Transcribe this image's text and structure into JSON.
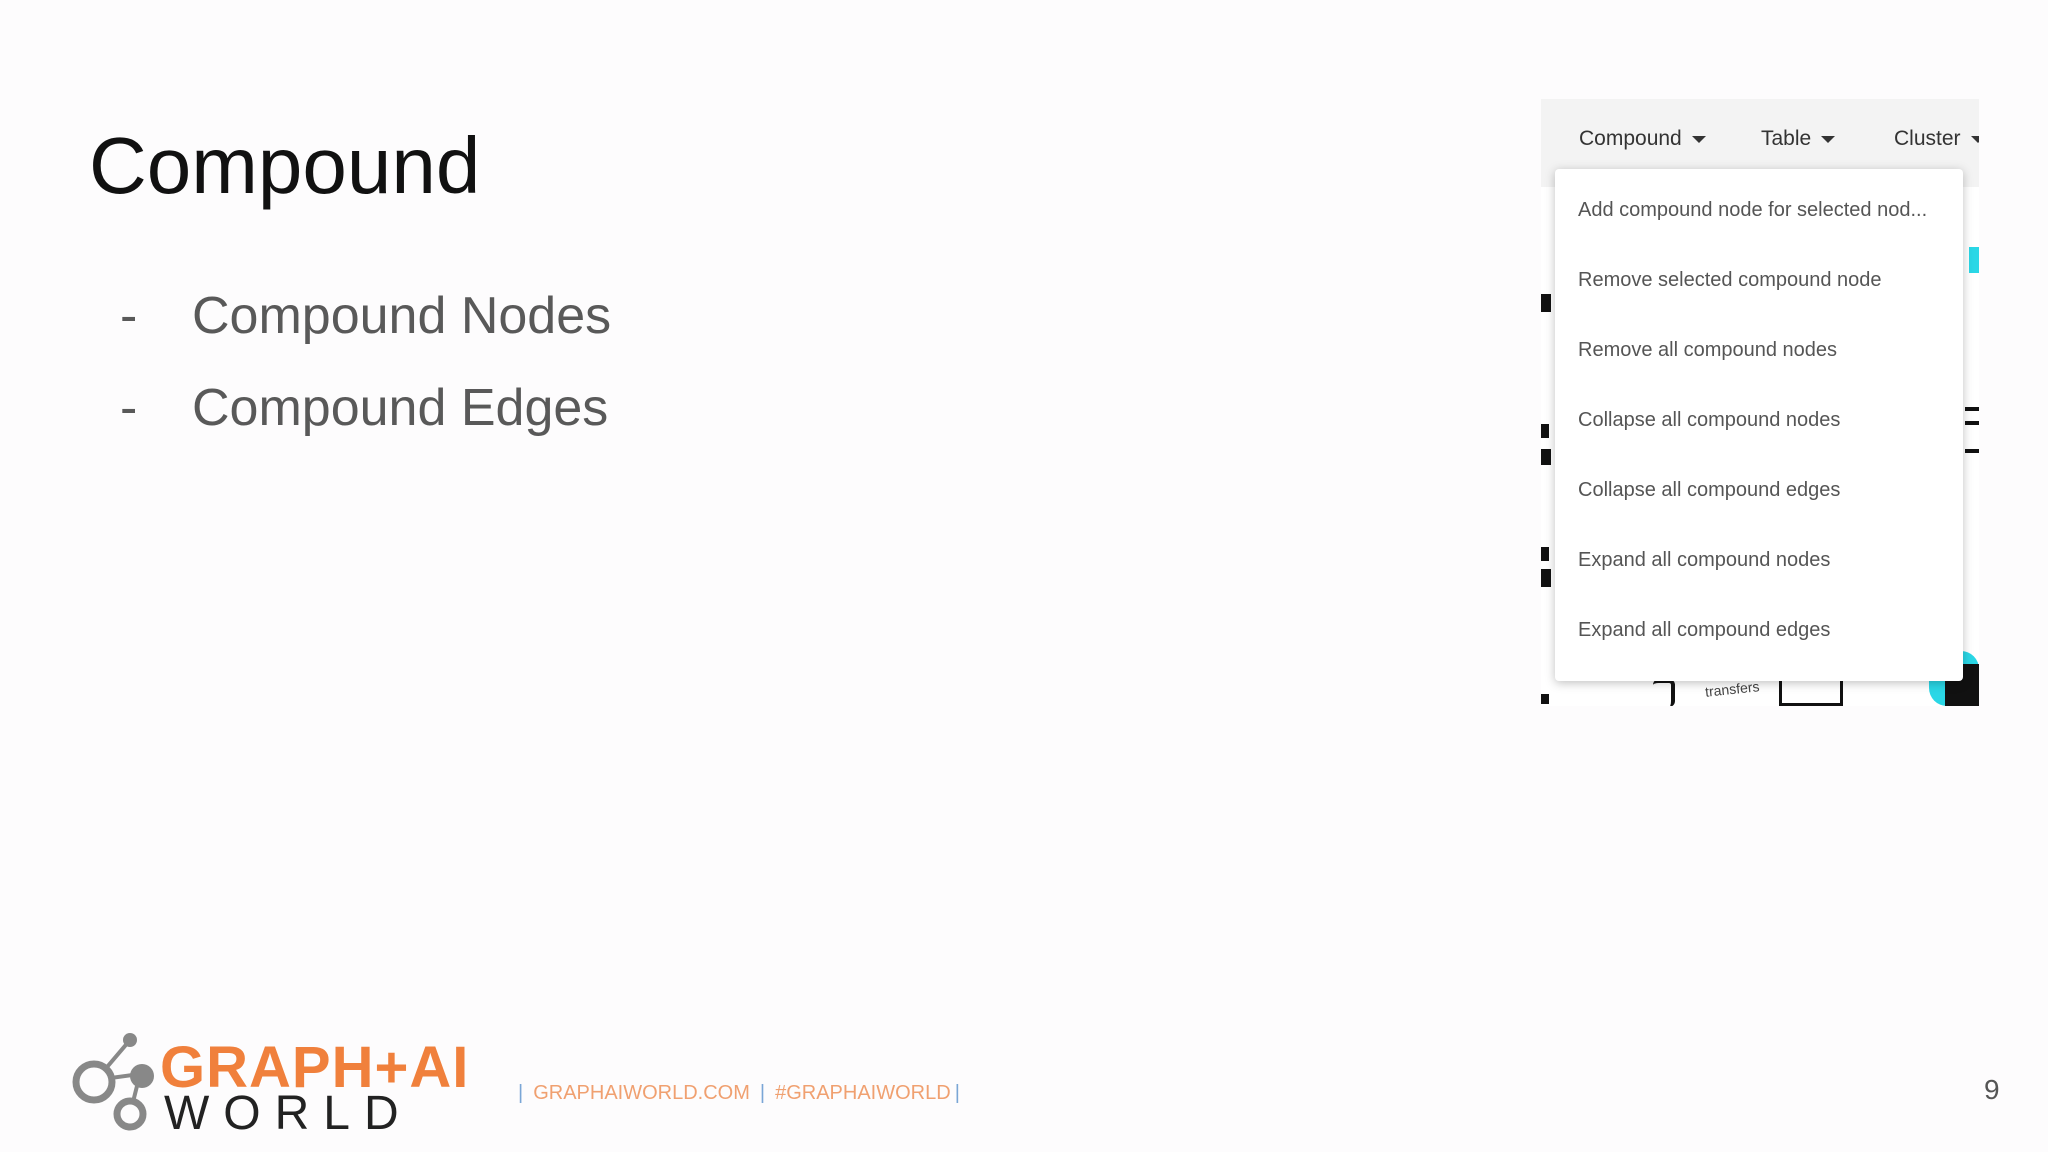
{
  "slide": {
    "title": "Compound",
    "bullets": [
      {
        "dash": "-",
        "text": "Compound Nodes"
      },
      {
        "dash": "-",
        "text": "Compound Edges"
      }
    ]
  },
  "screenshot": {
    "menubar": [
      {
        "label": "Compound"
      },
      {
        "label": "Table"
      },
      {
        "label": "Cluster"
      }
    ],
    "dropdown": [
      "Add compound node for selected nod...",
      "Remove selected compound node",
      "Remove all compound nodes",
      "Collapse all compound nodes",
      "Collapse all compound edges",
      "Expand all compound nodes",
      "Expand all compound edges"
    ],
    "background_label": "transfers",
    "colors": {
      "graph_accent": "#2ad7e6"
    }
  },
  "footer": {
    "logo_top": "GRAPH+AI",
    "logo_bottom": "WORLD",
    "link_site": "GRAPHAIWORLD.COM",
    "link_hashtag": "#GRAPHAIWORLD",
    "page_number": "9",
    "colors": {
      "brand_orange": "#f0803c",
      "link_orange": "#f0a070"
    }
  }
}
